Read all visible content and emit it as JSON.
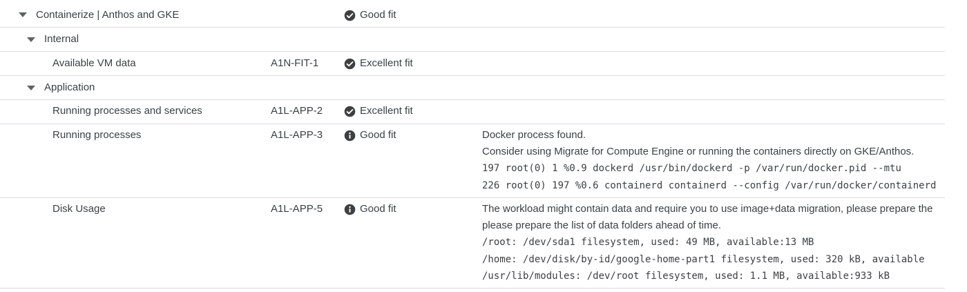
{
  "colors": {
    "icon": "#3c4043",
    "divider": "#dadce0",
    "text": "#3c4043"
  },
  "rows": [
    {
      "name": "Containerize | Anthos and GKE",
      "code": "",
      "status": "Good fit",
      "status_icon": "check-circle-icon",
      "expandable": true
    },
    {
      "name": "Internal",
      "code": "",
      "status": "",
      "expandable": true
    },
    {
      "name": "Available VM data",
      "code": "A1N-FIT-1",
      "status": "Excellent fit",
      "status_icon": "check-circle-icon"
    },
    {
      "name": "Application",
      "code": "",
      "status": "",
      "expandable": true
    },
    {
      "name": "Running processes and services",
      "code": "A1L-APP-2",
      "status": "Excellent fit",
      "status_icon": "check-circle-icon"
    },
    {
      "name": "Running processes",
      "code": "A1L-APP-3",
      "status": "Good fit",
      "status_icon": "info-icon",
      "details": {
        "text": [
          "Docker process found.",
          "Consider using Migrate for Compute Engine or running the containers directly on GKE/Anthos."
        ],
        "mono": [
          "197 root(0) 1 %0.9 dockerd /usr/bin/dockerd -p /var/run/docker.pid --mtu",
          "226 root(0) 197 %0.6 containerd containerd --config /var/run/docker/containerd"
        ]
      }
    },
    {
      "name": "Disk Usage",
      "code": "A1L-APP-5",
      "status": "Good fit",
      "status_icon": "info-icon",
      "details": {
        "text": [
          "The workload might contain data and require you to use image+data migration, please prepare the",
          "please prepare the list of data folders ahead of time."
        ],
        "mono": [
          "/root: /dev/sda1 filesystem, used: 49 MB, available:13 MB",
          "/home: /dev/disk/by-id/google-home-part1 filesystem, used: 320 kB, available",
          "/usr/lib/modules: /dev/root filesystem, used: 1.1 MB, available:933 kB"
        ]
      }
    }
  ]
}
